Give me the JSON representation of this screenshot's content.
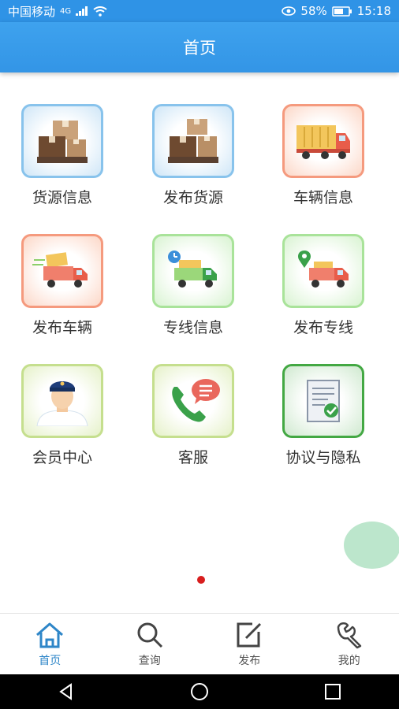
{
  "status_bar": {
    "carrier": "中国移动",
    "network": "4G",
    "battery": "58%",
    "time": "15:18"
  },
  "header": {
    "title": "首页"
  },
  "tiles": [
    {
      "label": "货源信息"
    },
    {
      "label": "发布货源"
    },
    {
      "label": "车辆信息"
    },
    {
      "label": "发布车辆"
    },
    {
      "label": "专线信息"
    },
    {
      "label": "发布专线"
    },
    {
      "label": "会员中心"
    },
    {
      "label": "客服"
    },
    {
      "label": "协议与隐私"
    }
  ],
  "tabbar": [
    {
      "label": "首页",
      "icon": "home-icon",
      "active": true
    },
    {
      "label": "查询",
      "icon": "search-icon"
    },
    {
      "label": "发布",
      "icon": "edit-icon"
    },
    {
      "label": "我的",
      "icon": "wrench-icon"
    }
  ],
  "colors": {
    "primary": "#3395e6",
    "active_tab": "#2e86c8",
    "page_dot": "#d81e1e",
    "fab": "#b5e3c7"
  }
}
